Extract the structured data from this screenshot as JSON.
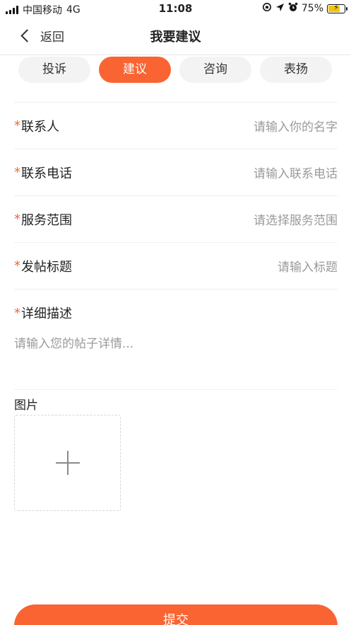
{
  "status_bar": {
    "carrier": "中国移动",
    "network": "4G",
    "time": "11:08",
    "battery_percent": "75%",
    "battery_level": 0.75
  },
  "nav": {
    "back_label": "返回",
    "title": "我要建议"
  },
  "tabs": [
    {
      "label": "投诉",
      "active": false
    },
    {
      "label": "建议",
      "active": true
    },
    {
      "label": "咨询",
      "active": false
    },
    {
      "label": "表扬",
      "active": false
    }
  ],
  "form": {
    "required_mark": "*",
    "contact": {
      "label": "联系人",
      "placeholder": "请输入你的名字"
    },
    "phone": {
      "label": "联系电话",
      "placeholder": "请输入联系电话"
    },
    "service": {
      "label": "服务范围",
      "placeholder": "请选择服务范围"
    },
    "post_title": {
      "label": "发帖标题",
      "placeholder": "请输入标题"
    },
    "detail": {
      "label": "详细描述",
      "placeholder": "请输入您的帖子详情..."
    }
  },
  "images": {
    "label": "图片"
  },
  "submit_label": "提交",
  "colors": {
    "accent": "#fa6332",
    "placeholder": "#9a9a9a",
    "tab_bg": "#f3f3f3"
  },
  "icons": [
    "signal-icon",
    "orientation-lock-icon",
    "location-arrow-icon",
    "alarm-icon",
    "battery-icon",
    "back-chevron-icon",
    "plus-icon"
  ]
}
